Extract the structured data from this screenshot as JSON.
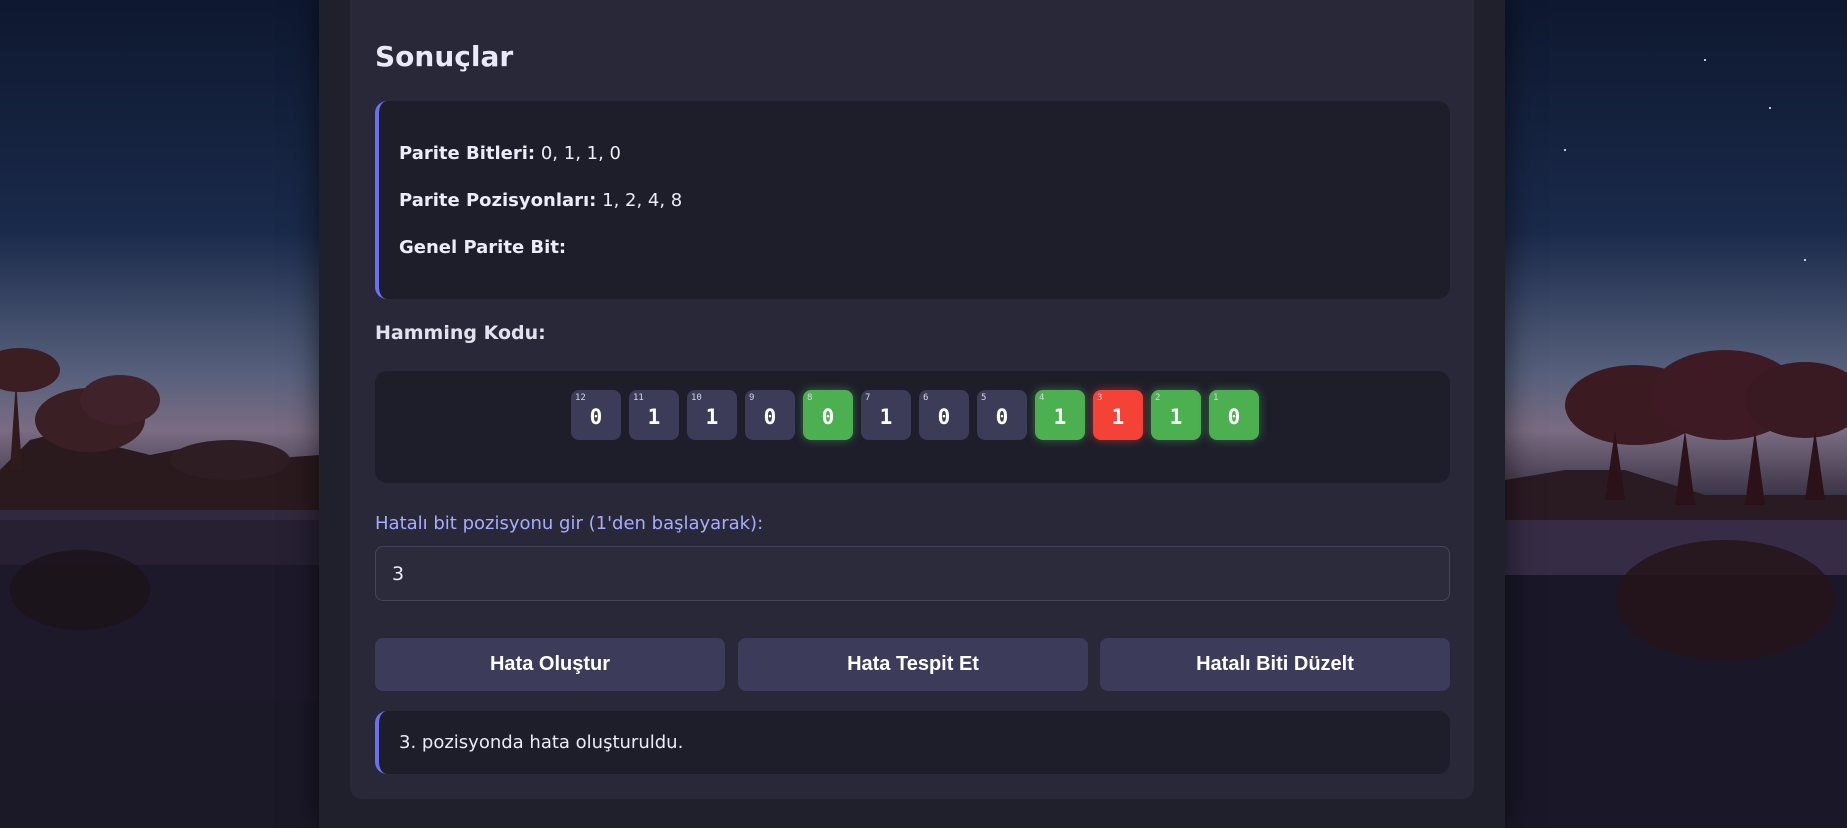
{
  "results": {
    "title": "Sonuçlar",
    "parity_bits_label": "Parite Bitleri:",
    "parity_bits_value": "0, 1, 1, 0",
    "parity_positions_label": "Parite Pozisyonları:",
    "parity_positions_value": "1, 2, 4, 8",
    "overall_parity_label": "Genel Parite Bit:",
    "overall_parity_value": ""
  },
  "hamming": {
    "label": "Hamming Kodu:",
    "bits": [
      {
        "pos": "12",
        "val": "0",
        "type": "data"
      },
      {
        "pos": "11",
        "val": "1",
        "type": "data"
      },
      {
        "pos": "10",
        "val": "1",
        "type": "data"
      },
      {
        "pos": "9",
        "val": "0",
        "type": "data"
      },
      {
        "pos": "8",
        "val": "0",
        "type": "parity"
      },
      {
        "pos": "7",
        "val": "1",
        "type": "data"
      },
      {
        "pos": "6",
        "val": "0",
        "type": "data"
      },
      {
        "pos": "5",
        "val": "0",
        "type": "data"
      },
      {
        "pos": "4",
        "val": "1",
        "type": "parity"
      },
      {
        "pos": "3",
        "val": "1",
        "type": "error"
      },
      {
        "pos": "2",
        "val": "1",
        "type": "parity"
      },
      {
        "pos": "1",
        "val": "0",
        "type": "parity"
      }
    ]
  },
  "error_input": {
    "label": "Hatalı bit pozisyonu gir (1'den başlayarak):",
    "value": "3"
  },
  "buttons": {
    "create_error": "Hata Oluştur",
    "detect_error": "Hata Tespit Et",
    "fix_error": "Hatalı Biti Düzelt"
  },
  "message": "3. pozisyonda hata oluşturuldu.",
  "colors": {
    "accent": "#6b6ff0",
    "parity_bit": "#4caf50",
    "error_bit": "#f44336",
    "data_bit": "#3c3c58"
  }
}
